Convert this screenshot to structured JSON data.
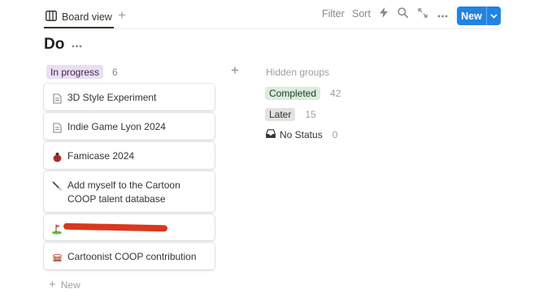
{
  "toolbar": {
    "view_tab_label": "Board view",
    "filter_label": "Filter",
    "sort_label": "Sort",
    "new_label": "New",
    "accent_color": "#2383e2"
  },
  "page": {
    "title": "Do"
  },
  "group": {
    "label": "In progress",
    "count": "6",
    "pill_color": "#eadff2",
    "text_color": "#412454"
  },
  "cards": [
    {
      "icon": "document-icon",
      "title": "3D Style Experiment"
    },
    {
      "icon": "document-icon",
      "title": "Indie Game Lyon 2024"
    },
    {
      "icon": "ladybug-icon",
      "title": "Famicase 2024"
    },
    {
      "icon": "brush-icon",
      "title": "Add myself to the Cartoon COOP talent database"
    },
    {
      "icon": "golf-flag-icon",
      "title": "",
      "redacted": true
    },
    {
      "icon": "drum-icon",
      "title": "Cartoonist COOP contribution"
    }
  ],
  "new_item_label": "New",
  "hidden_groups": {
    "title": "Hidden groups",
    "items": [
      {
        "label": "Completed",
        "count": "42",
        "color": "#dbeddb",
        "text_color": "#1c3829"
      },
      {
        "label": "Later",
        "count": "15",
        "color": "#e3e2e0",
        "text_color": "#32302c"
      },
      {
        "label": "No Status",
        "count": "0",
        "icon": "inbox-icon"
      }
    ]
  }
}
